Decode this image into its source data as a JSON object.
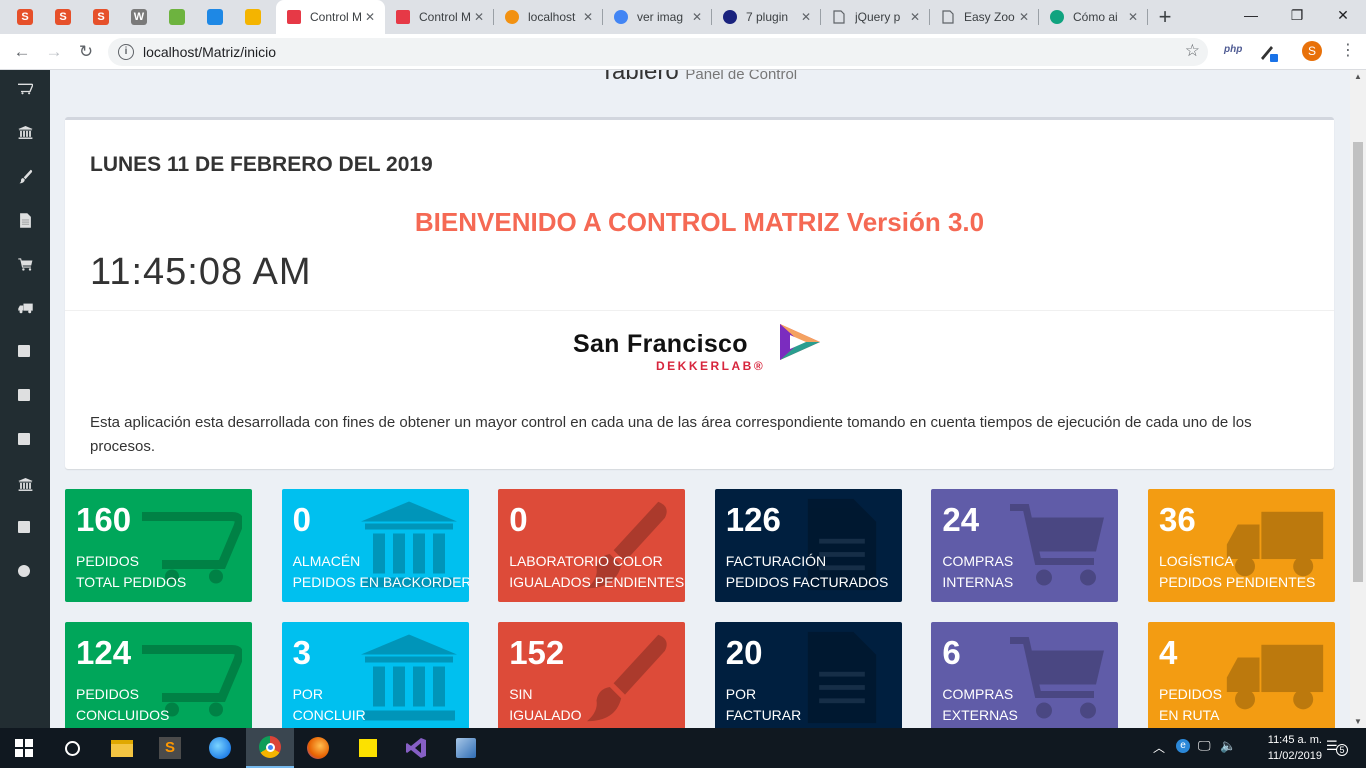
{
  "browser": {
    "pinned_tabs": [
      {
        "icon": "s-favicon",
        "color": "#e6502a",
        "glyph": "S"
      },
      {
        "icon": "s-favicon",
        "color": "#e6502a",
        "glyph": "S"
      },
      {
        "icon": "s-favicon",
        "color": "#e6502a",
        "glyph": "S"
      },
      {
        "icon": "wordpress-icon",
        "color": "#7a7a7a",
        "glyph": "W"
      },
      {
        "icon": "leaf-icon",
        "color": "#6db33f",
        "glyph": ""
      },
      {
        "icon": "mail-icon",
        "color": "#1e88e5",
        "glyph": ""
      },
      {
        "icon": "notes-icon",
        "color": "#f4b400",
        "glyph": ""
      }
    ],
    "tabs": [
      {
        "title": "Control M",
        "active": true,
        "favicon": "play-logo-icon"
      },
      {
        "title": "Control M",
        "active": false,
        "favicon": "play-logo-icon"
      },
      {
        "title": "localhost",
        "active": false,
        "favicon": "phpmyadmin-icon"
      },
      {
        "title": "ver imag",
        "active": false,
        "favicon": "google-icon"
      },
      {
        "title": "7 plugin",
        "active": false,
        "favicon": "graduation-cap-icon"
      },
      {
        "title": "jQuery p",
        "active": false,
        "favicon": "document-icon"
      },
      {
        "title": "Easy Zoo",
        "active": false,
        "favicon": "document-icon"
      },
      {
        "title": "Cómo ai",
        "active": false,
        "favicon": "circle-green-icon"
      }
    ],
    "new_tab": "+",
    "window_controls": {
      "minimize": "—",
      "restore": "❐",
      "close": "✕"
    },
    "address": "localhost/Matriz/inicio",
    "extensions": {
      "php": "php",
      "avatar": "S"
    }
  },
  "sidebar": {
    "items": [
      {
        "name": "cart-open-icon",
        "glyph": "⛟"
      },
      {
        "name": "bank-icon",
        "glyph": "🏛"
      },
      {
        "name": "brush-icon",
        "glyph": "🖌"
      },
      {
        "name": "file-icon",
        "glyph": "📄"
      },
      {
        "name": "cart-icon",
        "glyph": "🛒"
      },
      {
        "name": "truck-icon",
        "glyph": "🚚"
      },
      {
        "name": "copy-icon",
        "glyph": "📑"
      },
      {
        "name": "grid-icon",
        "glyph": "▦"
      },
      {
        "name": "bar-chart-icon",
        "glyph": "📊"
      },
      {
        "name": "bank-icon",
        "glyph": "🏛"
      },
      {
        "name": "spinner-icon",
        "glyph": "⁘"
      },
      {
        "name": "comment-icon",
        "glyph": "💬"
      }
    ]
  },
  "page": {
    "header_title": "Tablero",
    "header_subtitle": "Panel de Control",
    "date": "LUNES 11 DE FEBRERO DEL 2019",
    "welcome": "BIENVENIDO A CONTROL MATRIZ Versión 3.0",
    "clock": "11:45:08 AM",
    "logo_brand": "San Francisco",
    "logo_sub": "DEKKERLAB®",
    "description": "Esta aplicación esta desarrollada con fines de obtener un mayor control en cada una de las área correspondiente tomando en cuenta tiempos de ejecución de cada uno de los procesos."
  },
  "colors": {
    "green": "#00a65a",
    "aqua": "#00c0ef",
    "red": "#dd4b39",
    "navy": "#001f3f",
    "purple": "#605ca8",
    "orange": "#f39c12"
  },
  "row1": [
    {
      "number": "160",
      "line1": "PEDIDOS",
      "line2": "TOTAL PEDIDOS",
      "color": "#00a65a",
      "icon": "cart-open-icon"
    },
    {
      "number": "0",
      "line1": "ALMACÉN",
      "line2": "PEDIDOS EN BACKORDER",
      "color": "#00c0ef",
      "icon": "bank-icon"
    },
    {
      "number": "0",
      "line1": "LABORATORIO COLOR",
      "line2": "IGUALADOS PENDIENTES",
      "color": "#dd4b39",
      "icon": "brush-icon"
    },
    {
      "number": "126",
      "line1": "FACTURACIÓN",
      "line2": "PEDIDOS FACTURADOS",
      "color": "#001f3f",
      "icon": "file-icon"
    },
    {
      "number": "24",
      "line1": "COMPRAS",
      "line2": "INTERNAS",
      "color": "#605ca8",
      "icon": "cart-icon"
    },
    {
      "number": "36",
      "line1": "LOGÍSTICA",
      "line2": "PEDIDOS PENDIENTES",
      "color": "#f39c12",
      "icon": "truck-icon"
    }
  ],
  "row2": [
    {
      "number": "124",
      "line1": "PEDIDOS",
      "line2": "CONCLUIDOS",
      "color": "#00a65a",
      "icon": "cart-open-icon"
    },
    {
      "number": "3",
      "line1": "POR",
      "line2": "CONCLUIR",
      "color": "#00c0ef",
      "icon": "bank-icon"
    },
    {
      "number": "152",
      "line1": "SIN",
      "line2": "IGUALADO",
      "color": "#dd4b39",
      "icon": "brush-icon"
    },
    {
      "number": "20",
      "line1": "POR",
      "line2": "FACTURAR",
      "color": "#001f3f",
      "icon": "file-icon"
    },
    {
      "number": "6",
      "line1": "COMPRAS",
      "line2": "EXTERNAS",
      "color": "#605ca8",
      "icon": "cart-icon"
    },
    {
      "number": "4",
      "line1": "PEDIDOS",
      "line2": "EN RUTA",
      "color": "#f39c12",
      "icon": "truck-icon"
    }
  ],
  "taskbar": {
    "time": "11:45 a. m.",
    "date": "11/02/2019",
    "notifications": "5"
  }
}
